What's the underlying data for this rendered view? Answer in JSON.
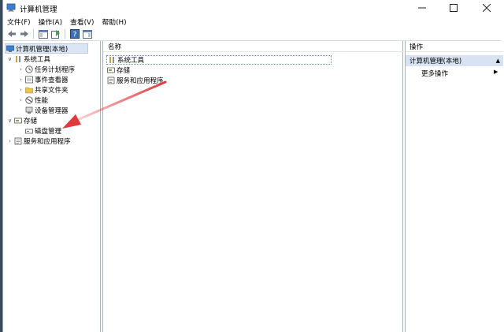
{
  "window": {
    "title": "计算机管理"
  },
  "menu": [
    "文件(F)",
    "操作(A)",
    "查看(V)",
    "帮助(H)"
  ],
  "tree": {
    "root": "计算机管理(本地)",
    "system_tools": "系统工具",
    "task_scheduler": "任务计划程序",
    "event_viewer": "事件查看器",
    "shared_folders": "共享文件夹",
    "performance": "性能",
    "device_manager": "设备管理器",
    "storage": "存储",
    "disk_management": "磁盘管理",
    "services_apps": "服务和应用程序"
  },
  "center": {
    "column_name": "名称",
    "items": [
      "系统工具",
      "存储",
      "服务和应用程序"
    ]
  },
  "actions": {
    "title": "操作",
    "section": "计算机管理(本地)",
    "more": "更多操作"
  },
  "colors": {
    "annotation_arrow": "#e0393e",
    "selection": "#dbe6f4"
  }
}
